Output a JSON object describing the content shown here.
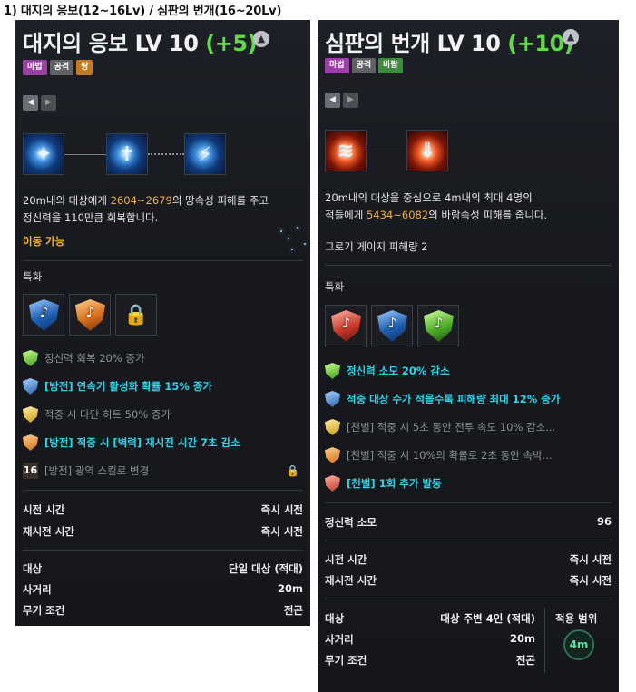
{
  "heading": "1) 대지의 응보(12~16Lv) / 심판의 번개(16~20Lv)",
  "left": {
    "title": "대지의 응보 LV 10",
    "title_plus": "(+5)",
    "up_icon": "up-arrow-icon",
    "tags": [
      "마법",
      "공격",
      "땅"
    ],
    "tag_colors": [
      "#9c3fa6",
      "#5f6166",
      "#c57a1e"
    ],
    "nav_prev": "◀",
    "nav_next": "▶",
    "desc_line1_a": "20m내의 대상에게 ",
    "desc_line1_num": "2604~2679",
    "desc_line1_b": "의 땅속성 피해를 주고",
    "desc_line2": "정신력을 110만큼 회복합니다.",
    "move_text": "이동 가능",
    "spec_label": "특화",
    "traits": [
      {
        "text": "정신력 회복 20% 증가",
        "color": "dim"
      },
      {
        "text": "[방전] 연속기 활성화 확률 15% 증가",
        "color": "cyan"
      },
      {
        "text": "적중 시 다단 히트 50% 증가",
        "color": "dim"
      },
      {
        "text": "[방전] 적중 시 [벽력] 재시전 시간 7초 감소",
        "color": "cyan"
      },
      {
        "text": "[방전] 광역 스킬로 변경",
        "color": "dim",
        "level": "16"
      }
    ],
    "stats1": [
      {
        "k": "시전 시간",
        "v": "즉시 시전"
      },
      {
        "k": "재시전 시간",
        "v": "즉시 시전"
      }
    ],
    "stats2": [
      {
        "k": "대상",
        "v": "단일 대상 (적대)"
      },
      {
        "k": "사거리",
        "v": "20m"
      },
      {
        "k": "무기 조건",
        "v": "전곤"
      }
    ]
  },
  "right": {
    "title": "심판의 번개 LV 10",
    "title_plus": "(+10)",
    "up_icon": "up-arrow-icon",
    "tags": [
      "마법",
      "공격",
      "바람"
    ],
    "tag_colors": [
      "#9c3fa6",
      "#5f6166",
      "#3f8a3f"
    ],
    "nav_prev": "◀",
    "nav_next": "▶",
    "desc_line1": "20m내의 대상을 중심으로 4m내의 최대 4명의",
    "desc_line2_a": "적들에게 ",
    "desc_line2_num": "5434~6082",
    "desc_line2_b": "의 바람속성 피해를 줍니다.",
    "gauge_text": "그로기 게이지 피해량 2",
    "spec_label": "특화",
    "traits": [
      {
        "text": "정신력 소모 20% 감소",
        "color": "cyan"
      },
      {
        "text": "적중 대상 수가 적을수록 피해량 최대 12% 증가",
        "color": "cyan"
      },
      {
        "text": "[천벌] 적중 시 5초 동안 전투 속도 10% 감소...",
        "color": "dim"
      },
      {
        "text": "[천벌] 적중 시 10%의 확률로 2초 동안 속박...",
        "color": "dim"
      },
      {
        "text": "[천벌] 1회 추가 발동",
        "color": "cyan"
      }
    ],
    "mp_cost_label": "정신력 소모",
    "mp_cost_value": "96",
    "stats1": [
      {
        "k": "시전 시간",
        "v": "즉시 시전"
      },
      {
        "k": "재시전 시간",
        "v": "즉시 시전"
      }
    ],
    "stats2": [
      {
        "k": "대상",
        "v": "대상 주변 4인 (적대)"
      },
      {
        "k": "사거리",
        "v": "20m"
      },
      {
        "k": "무기 조건",
        "v": "전곤"
      }
    ],
    "range_label": "적용 범위",
    "range_value": "4m"
  }
}
